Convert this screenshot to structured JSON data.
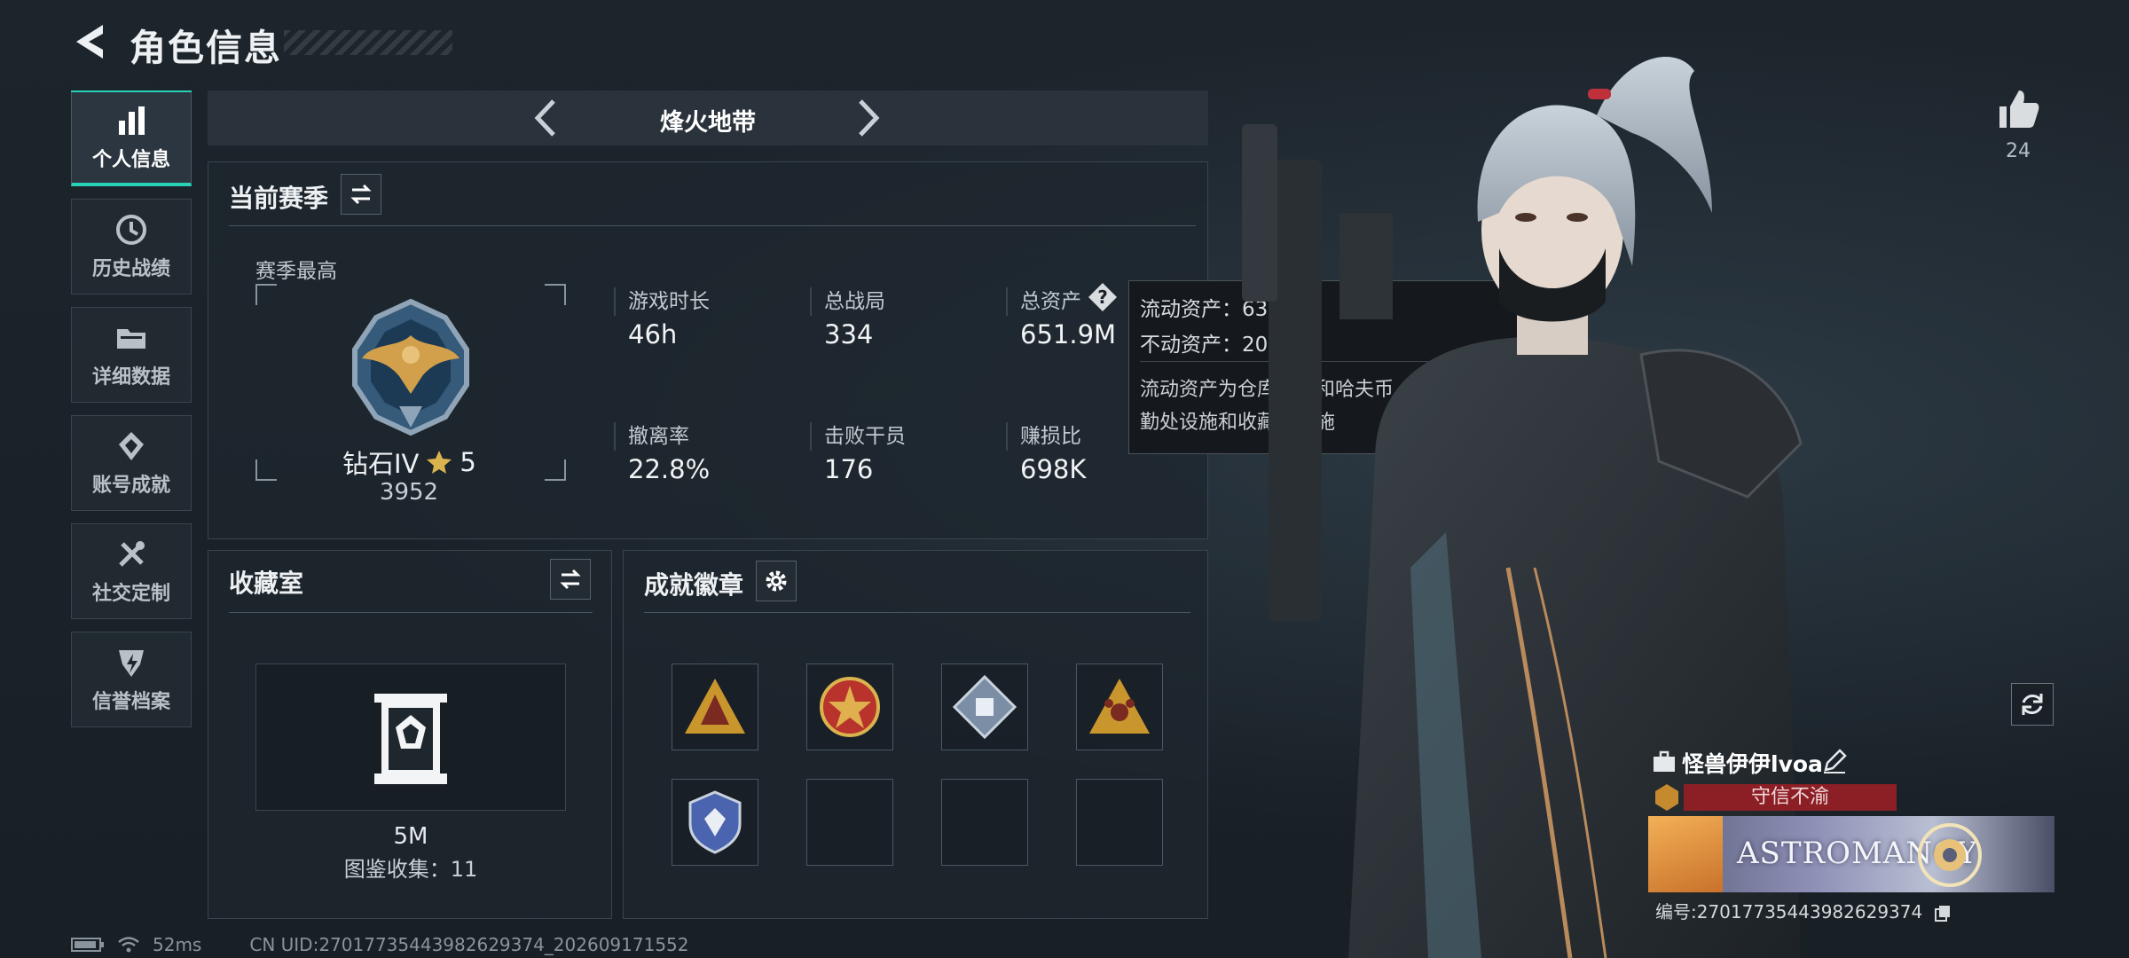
{
  "header": {
    "title": "角色信息"
  },
  "sidebar": {
    "items": [
      {
        "label": "个人信息",
        "icon": "bar-chart-icon",
        "active": true
      },
      {
        "label": "历史战绩",
        "icon": "history-clock-icon",
        "active": false
      },
      {
        "label": "详细数据",
        "icon": "folder-icon",
        "active": false
      },
      {
        "label": "账号成就",
        "icon": "achievement-diamond-icon",
        "active": false
      },
      {
        "label": "社交定制",
        "icon": "wrench-screwdriver-icon",
        "active": false
      },
      {
        "label": "信誉档案",
        "icon": "shield-lightning-icon",
        "active": false
      }
    ]
  },
  "mode_selector": {
    "title": "烽火地带"
  },
  "season": {
    "title": "当前赛季",
    "best_label": "赛季最高",
    "rank_name": "钻石IV",
    "rank_stars": "5",
    "rank_score": "3952",
    "stats": [
      {
        "label": "游戏时长",
        "value": "46h"
      },
      {
        "label": "总战局",
        "value": "334"
      },
      {
        "label": "总资产",
        "value": "651.9M"
      },
      {
        "label": "撤离率",
        "value": "22.8%"
      },
      {
        "label": "击败干员",
        "value": "176"
      },
      {
        "label": "赚损比",
        "value": "698K"
      }
    ]
  },
  "tooltip": {
    "liquid": "流动资产：631.5M",
    "fixed": "不动资产：20.4M",
    "description": "流动资产为仓库资产和哈夫币，不动资产为特勤处设施和收藏室设施"
  },
  "collection": {
    "title": "收藏室",
    "value": "5M",
    "count_text": "图鉴收集：11"
  },
  "badges": {
    "title": "成就徽章",
    "slots": [
      {
        "filled": true,
        "color": "#c9962e"
      },
      {
        "filled": true,
        "color": "#b8332c"
      },
      {
        "filled": true,
        "color": "#7b8ea6"
      },
      {
        "filled": true,
        "color": "#c9962e"
      },
      {
        "filled": true,
        "color": "#4b64b0"
      },
      {
        "filled": false
      },
      {
        "filled": false
      },
      {
        "filled": false
      }
    ]
  },
  "status": {
    "ping": "52ms",
    "uid": "CN UID:27017735443982629374_202609171552"
  },
  "likes": {
    "count": "24"
  },
  "player": {
    "name": "怪兽伊伊lvoa",
    "motto": "守信不渝",
    "banner_text": "ASTROMANCY",
    "id_text": "编号:27017735443982629374"
  },
  "colors": {
    "accent": "#29d1b6",
    "motto_bg": "#8c1f26"
  }
}
